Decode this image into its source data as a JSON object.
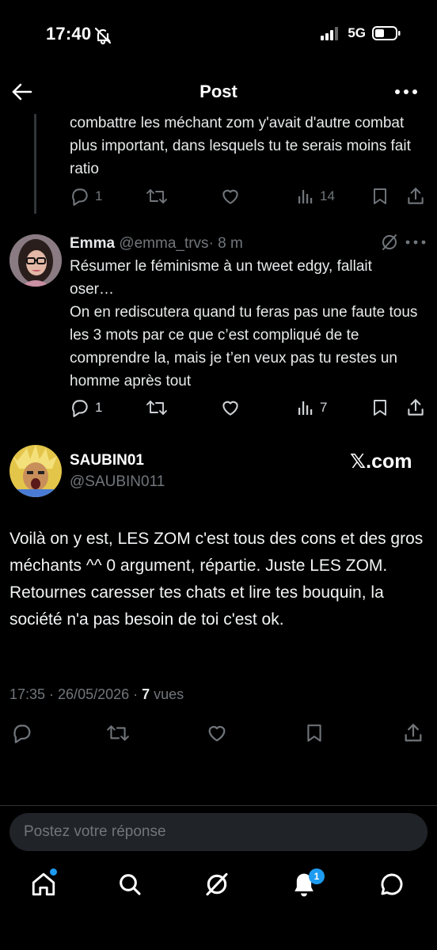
{
  "status_bar": {
    "time": "17:40",
    "network": "5G"
  },
  "header": {
    "title": "Post"
  },
  "parent_tweet": {
    "text": "combattre les méchant zom y'avait d'autre combat plus important, dans lesquels tu te serais moins fait ratio",
    "replies": "1",
    "views": "14"
  },
  "reply_tweet": {
    "name": "Emma",
    "handle": "@emma_trvs",
    "time": "· 8 m",
    "text": "Résumer le féminisme à un tweet edgy, fallait oser…\nOn en rediscutera quand tu feras pas une faute tous les 3 mots par ce que c’est compliqué de te comprendre la, mais je t’en veux pas tu restes un homme après tout",
    "replies": "1",
    "views": "7"
  },
  "main_tweet": {
    "name": "SAUBIN01",
    "handle": "@SAUBIN011",
    "brand": "𝕏.com",
    "text": "Voilà on y est, LES ZOM c'est tous des cons et des gros méchants ^^ 0 argument, répartie. Juste LES ZOM. Retournes caresser tes chats et lire tes bouquin, la société n'a pas besoin de toi c'est ok.",
    "timestamp": "17:35 · 26/05/2026 · ",
    "views_count": "7",
    "views_label": " vues"
  },
  "reply_input": {
    "placeholder": "Postez votre réponse"
  },
  "bottom_nav": {
    "notifications_badge": "1"
  },
  "colors": {
    "background": "#000000",
    "text": "#e7e9ea",
    "muted": "#71767b",
    "accent": "#1d9bf0"
  }
}
